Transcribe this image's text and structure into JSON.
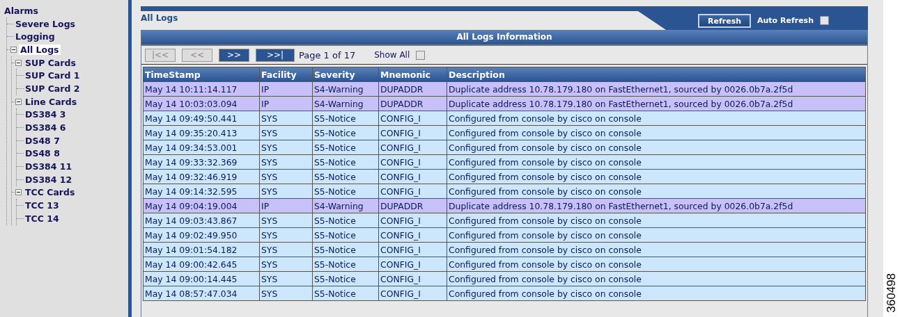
{
  "sidebar": {
    "tree": [
      {
        "label": "Alarms",
        "selected": false,
        "children": [
          {
            "label": "Severe Logs",
            "selected": false
          },
          {
            "label": "Logging",
            "selected": false
          },
          {
            "label": "All Logs",
            "selected": true,
            "expanded": true,
            "children": [
              {
                "label": "SUP Cards",
                "selected": false,
                "expanded": true,
                "children": [
                  {
                    "label": "SUP Card 1",
                    "selected": false
                  },
                  {
                    "label": "SUP Card 2",
                    "selected": false
                  }
                ]
              },
              {
                "label": "Line Cards",
                "selected": false,
                "expanded": true,
                "children": [
                  {
                    "label": "DS384 3",
                    "selected": false
                  },
                  {
                    "label": "DS384 6",
                    "selected": false
                  },
                  {
                    "label": "DS48 7",
                    "selected": false
                  },
                  {
                    "label": "DS48 8",
                    "selected": false
                  },
                  {
                    "label": "DS384 11",
                    "selected": false
                  },
                  {
                    "label": "DS384 12",
                    "selected": false
                  }
                ]
              },
              {
                "label": "TCC Cards",
                "selected": false,
                "expanded": true,
                "children": [
                  {
                    "label": "TCC 13",
                    "selected": false
                  },
                  {
                    "label": "TCC 14",
                    "selected": false
                  }
                ]
              }
            ]
          }
        ]
      }
    ]
  },
  "header": {
    "title": "All Logs",
    "refresh_button": "Refresh",
    "auto_refresh": {
      "label": "Auto Refresh",
      "checked": false
    }
  },
  "panel": {
    "title": "All Logs Information",
    "pager": {
      "buttons": [
        {
          "label": "|<<",
          "disabled": true
        },
        {
          "label": "<<",
          "disabled": true
        },
        {
          "label": ">>",
          "disabled": false
        },
        {
          "label": ">>|",
          "disabled": false
        }
      ],
      "page_text": "Page 1 of 17",
      "show_all": {
        "label": "Show All",
        "checked": false
      }
    },
    "table": {
      "columns": [
        "TimeStamp",
        "Facility",
        "Severity",
        "Mnemonic",
        "Description"
      ],
      "rows": [
        {
          "color": "#c8c0f8",
          "cells": [
            "May 14 10:11:14.117",
            "IP",
            "S4-Warning",
            "DUPADDR",
            "Duplicate address 10.78.179.180 on FastEthernet1, sourced by 0026.0b7a.2f5d"
          ]
        },
        {
          "color": "#c8c0f8",
          "cells": [
            "May 14 10:03:03.094",
            "IP",
            "S4-Warning",
            "DUPADDR",
            "Duplicate address 10.78.179.180 on FastEthernet1, sourced by 0026.0b7a.2f5d"
          ]
        },
        {
          "color": "#cce6fc",
          "cells": [
            "May 14 09:49:50.441",
            "SYS",
            "S5-Notice",
            "CONFIG_I",
            "Configured from console by cisco on console"
          ]
        },
        {
          "color": "#cce6fc",
          "cells": [
            "May 14 09:35:20.413",
            "SYS",
            "S5-Notice",
            "CONFIG_I",
            "Configured from console by cisco on console"
          ]
        },
        {
          "color": "#cce6fc",
          "cells": [
            "May 14 09:34:53.001",
            "SYS",
            "S5-Notice",
            "CONFIG_I",
            "Configured from console by cisco on console"
          ]
        },
        {
          "color": "#cce6fc",
          "cells": [
            "May 14 09:33:32.369",
            "SYS",
            "S5-Notice",
            "CONFIG_I",
            "Configured from console by cisco on console"
          ]
        },
        {
          "color": "#cce6fc",
          "cells": [
            "May 14 09:32:46.919",
            "SYS",
            "S5-Notice",
            "CONFIG_I",
            "Configured from console by cisco on console"
          ]
        },
        {
          "color": "#cce6fc",
          "cells": [
            "May 14 09:14:32.595",
            "SYS",
            "S5-Notice",
            "CONFIG_I",
            "Configured from console by cisco on console"
          ]
        },
        {
          "color": "#c8c0f8",
          "cells": [
            "May 14 09:04:19.004",
            "IP",
            "S4-Warning",
            "DUPADDR",
            "Duplicate address 10.78.179.180 on FastEthernet1, sourced by 0026.0b7a.2f5d"
          ]
        },
        {
          "color": "#cce6fc",
          "cells": [
            "May 14 09:03:43.867",
            "SYS",
            "S5-Notice",
            "CONFIG_I",
            "Configured from console by cisco on console"
          ]
        },
        {
          "color": "#cce6fc",
          "cells": [
            "May 14 09:02:49.950",
            "SYS",
            "S5-Notice",
            "CONFIG_I",
            "Configured from console by cisco on console"
          ]
        },
        {
          "color": "#cce6fc",
          "cells": [
            "May 14 09:01:54.182",
            "SYS",
            "S5-Notice",
            "CONFIG_I",
            "Configured from console by cisco on console"
          ]
        },
        {
          "color": "#cce6fc",
          "cells": [
            "May 14 09:00:42.645",
            "SYS",
            "S5-Notice",
            "CONFIG_I",
            "Configured from console by cisco on console"
          ]
        },
        {
          "color": "#cce6fc",
          "cells": [
            "May 14 09:00:14.445",
            "SYS",
            "S5-Notice",
            "CONFIG_I",
            "Configured from console by cisco on console"
          ]
        },
        {
          "color": "#cce6fc",
          "cells": [
            "May 14 08:57:47.034",
            "SYS",
            "S5-Notice",
            "CONFIG_I",
            "Configured from console by cisco on console"
          ]
        }
      ]
    }
  },
  "figure_number": "360498"
}
